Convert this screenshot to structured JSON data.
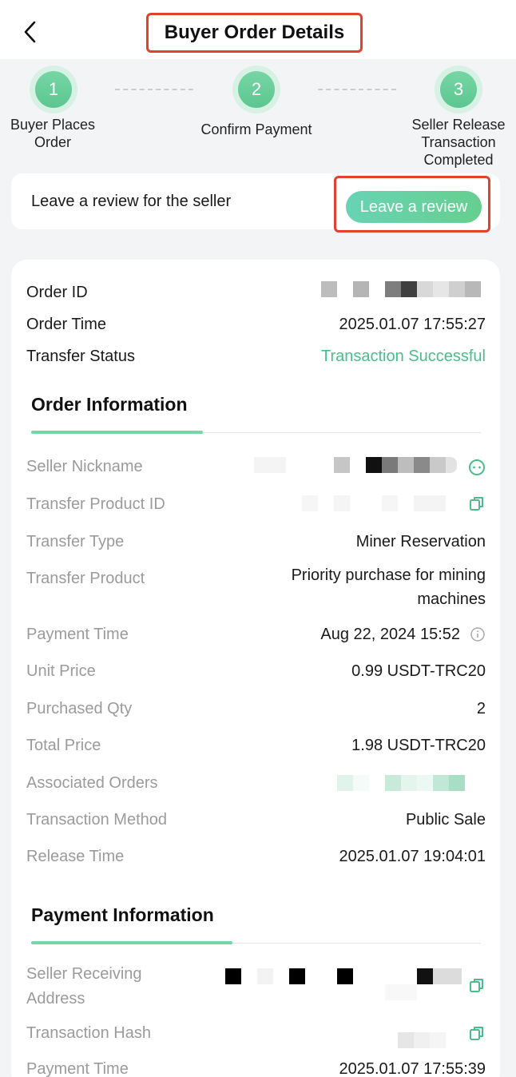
{
  "header": {
    "title": "Buyer Order Details"
  },
  "steps": [
    {
      "number": "1",
      "label": "Buyer Places Order"
    },
    {
      "number": "2",
      "label": "Confirm Payment"
    },
    {
      "number": "3",
      "label": "Seller Release Transaction Completed"
    }
  ],
  "review": {
    "prompt": "Leave a review for the seller",
    "button_label": "Leave a review"
  },
  "summary": {
    "order_id_label": "Order ID",
    "order_time_label": "Order Time",
    "order_time": "2025.01.07 17:55:27",
    "transfer_status_label": "Transfer Status",
    "transfer_status": "Transaction Successful"
  },
  "order_info": {
    "title": "Order Information",
    "seller_nickname_label": "Seller Nickname",
    "transfer_product_id_label": "Transfer Product ID",
    "transfer_type_label": "Transfer Type",
    "transfer_type": "Miner Reservation",
    "transfer_product_label": "Transfer Product",
    "transfer_product_line1": "Priority purchase for mining",
    "transfer_product_line2": "machines",
    "payment_time_label": "Payment Time",
    "payment_time": "Aug 22, 2024 15:52",
    "unit_price_label": "Unit Price",
    "unit_price": "0.99 USDT-TRC20",
    "purchased_qty_label": "Purchased Qty",
    "purchased_qty": "2",
    "total_price_label": "Total Price",
    "total_price": "1.98 USDT-TRC20",
    "associated_orders_label": "Associated Orders",
    "transaction_method_label": "Transaction Method",
    "transaction_method": "Public Sale",
    "release_time_label": "Release Time",
    "release_time": "2025.01.07 19:04:01"
  },
  "payment_info": {
    "title": "Payment Information",
    "seller_address_label_line1": "Seller Receiving",
    "seller_address_label_line2": "Address",
    "transaction_hash_label": "Transaction Hash",
    "payment_time_label": "Payment Time",
    "payment_time": "2025.01.07 17:55:39"
  },
  "colors": {
    "accent_green": "#4cbd8a",
    "highlight_red": "#e3412d",
    "step_green": "#5cc690"
  },
  "icons": [
    "back-arrow-icon",
    "chat-icon",
    "copy-icon",
    "info-icon"
  ]
}
